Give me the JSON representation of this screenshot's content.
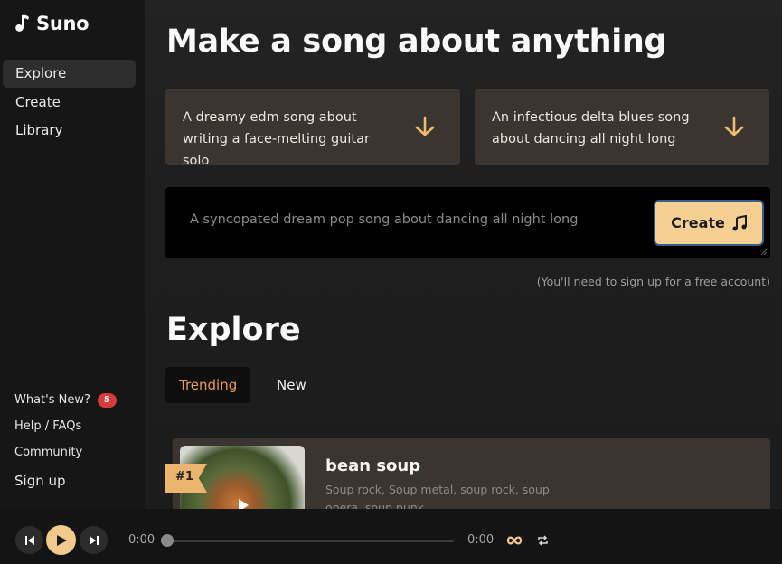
{
  "app": {
    "name": "Suno"
  },
  "sidebar": {
    "items": [
      {
        "label": "Explore",
        "active": true
      },
      {
        "label": "Create",
        "active": false
      },
      {
        "label": "Library",
        "active": false
      }
    ],
    "bottom": {
      "whats_new": "What's New?",
      "whats_new_count": "5",
      "help": "Help / FAQs",
      "community": "Community",
      "sign_up": "Sign up"
    }
  },
  "hero": {
    "title": "Make a song about anything",
    "suggestions": [
      {
        "text": "A dreamy edm song about writing a face-melting guitar solo",
        "icon": "arrow-down-icon"
      },
      {
        "text": "An infectious delta blues song about dancing all night long",
        "icon": "arrow-down-icon"
      }
    ],
    "prompt_placeholder": "A syncopated dream pop song about dancing all night long",
    "create_label": "Create",
    "signup_note": "(You'll need to sign up for a free account)"
  },
  "explore": {
    "title": "Explore",
    "tabs": [
      {
        "label": "Trending",
        "active": true
      },
      {
        "label": "New",
        "active": false
      }
    ],
    "songs": [
      {
        "rank": "#1",
        "title": "bean soup",
        "tags": "Soup rock, Soup metal, soup rock, soup opera, soup punk"
      }
    ]
  },
  "player": {
    "current_time": "0:00",
    "duration": "0:00",
    "progress": 0
  },
  "colors": {
    "accent": "#f4ca8c",
    "trending": "#ea9a58",
    "badge": "#d83b3b",
    "card": "#3a3530"
  }
}
